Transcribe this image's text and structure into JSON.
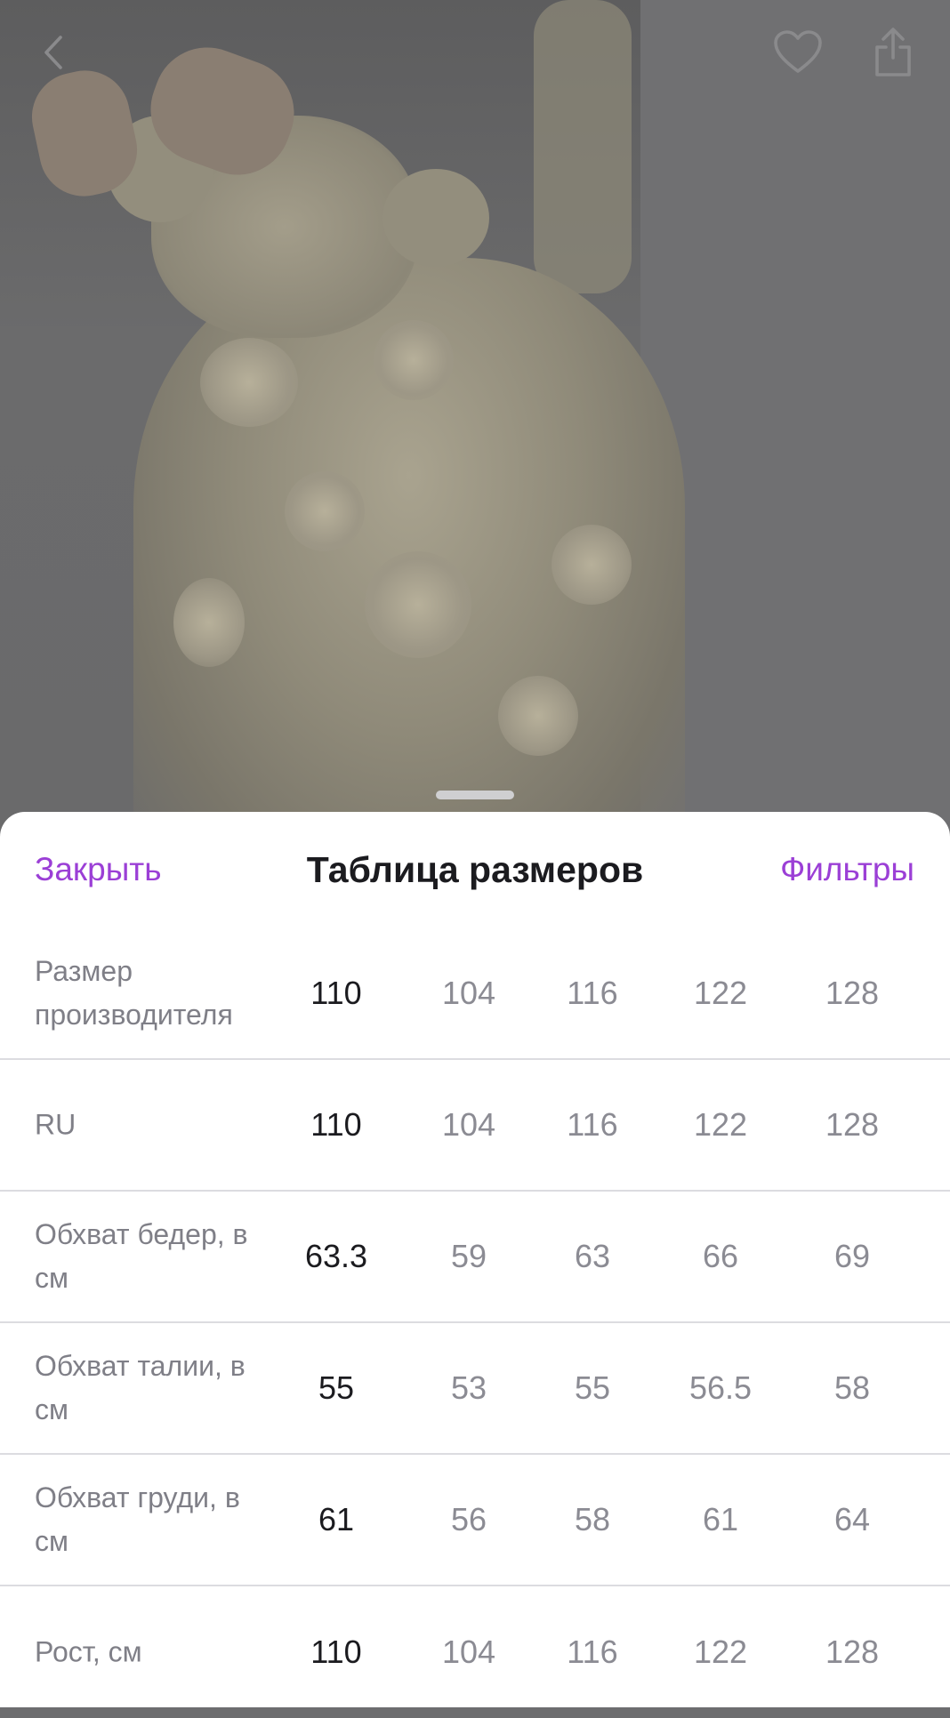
{
  "size_table": {
    "close_label": "Закрыть",
    "title": "Таблица размеров",
    "filters_label": "Фильтры",
    "rows": [
      {
        "label": "Размер производителя",
        "values": [
          "110",
          "104",
          "116",
          "122",
          "128"
        ]
      },
      {
        "label": "RU",
        "values": [
          "110",
          "104",
          "116",
          "122",
          "128"
        ]
      },
      {
        "label": "Обхват бедер, в см",
        "values": [
          "63.3",
          "59",
          "63",
          "66",
          "69"
        ]
      },
      {
        "label": "Обхват талии, в см",
        "values": [
          "55",
          "53",
          "55",
          "56.5",
          "58"
        ]
      },
      {
        "label": "Обхват груди, в см",
        "values": [
          "61",
          "56",
          "58",
          "61",
          "64"
        ]
      },
      {
        "label": "Рост, см",
        "values": [
          "110",
          "104",
          "116",
          "122",
          "128"
        ]
      }
    ]
  },
  "icons": {
    "back": "chevron-left-icon",
    "favorite": "heart-icon",
    "share": "share-icon"
  },
  "colors": {
    "accent": "#9b3fd6",
    "selected_text": "#1b1b1f",
    "muted_text": "#8b8b93",
    "overlay": "#6d6d6f"
  }
}
